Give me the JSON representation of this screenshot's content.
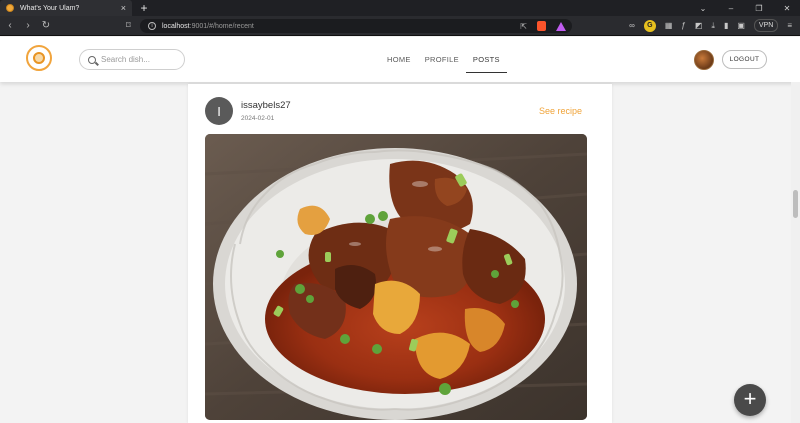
{
  "browser": {
    "tab_title": "What's Your Ulam?",
    "url_host": "localhost",
    "url_rest": ":9001/#/home/recent",
    "vpn_label": "VPN"
  },
  "header": {
    "search_placeholder": "Search dish...",
    "nav": [
      "HOME",
      "PROFILE",
      "POSTS"
    ],
    "active_nav": "POSTS",
    "logout_label": "LOGOUT"
  },
  "post": {
    "avatar_initial": "I",
    "username": "issaybels27",
    "date": "2024-02-01",
    "see_recipe_label": "See recipe"
  },
  "fab": {
    "label": "+"
  },
  "colors": {
    "accent": "#f0a43a",
    "dark": "#4a4a4a"
  },
  "icons": [
    "search-icon",
    "plus-icon",
    "close-icon",
    "reload-icon",
    "bookmark-icon",
    "info-icon"
  ]
}
